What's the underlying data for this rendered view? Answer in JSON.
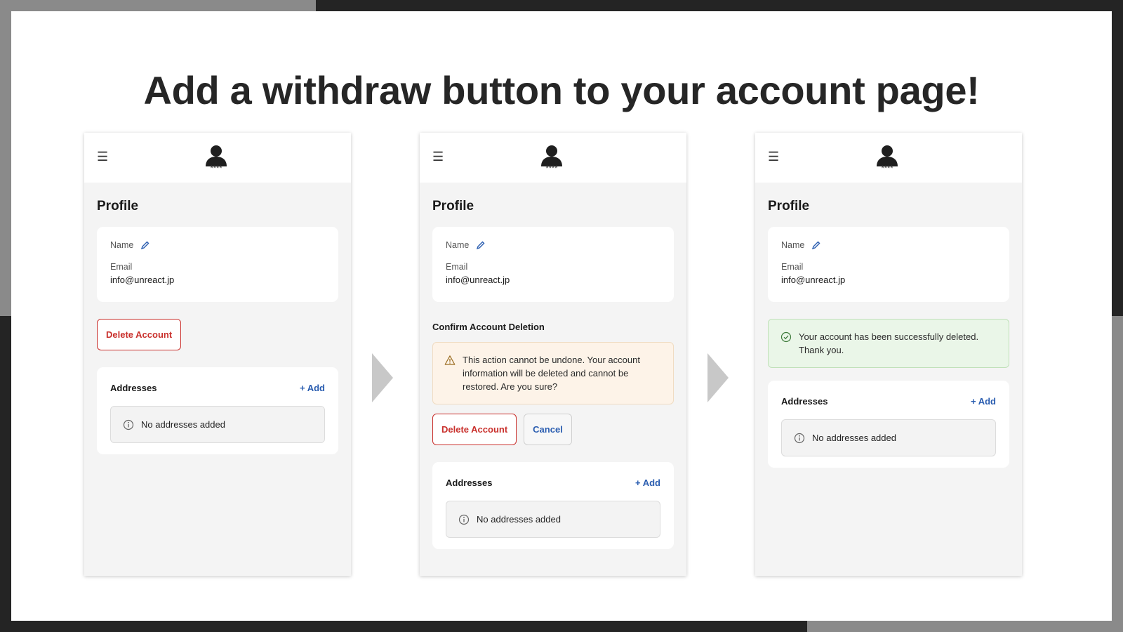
{
  "headline": "Add a withdraw button to your account page!",
  "logo_stars": "****",
  "screens": [
    {
      "profile_title": "Profile",
      "name_label": "Name",
      "email_label": "Email",
      "email_value": "info@unreact.jp",
      "delete_button": "Delete Account",
      "addresses_title": "Addresses",
      "add_link": "+ Add",
      "empty_text": "No addresses added"
    },
    {
      "profile_title": "Profile",
      "name_label": "Name",
      "email_label": "Email",
      "email_value": "info@unreact.jp",
      "confirm_title": "Confirm Account Deletion",
      "warning_text": "This action cannot be undone. Your account information will be deleted and cannot be restored. Are you sure?",
      "delete_button": "Delete Account",
      "cancel_button": "Cancel",
      "addresses_title": "Addresses",
      "add_link": "+ Add",
      "empty_text": "No addresses added"
    },
    {
      "profile_title": "Profile",
      "name_label": "Name",
      "email_label": "Email",
      "email_value": "info@unreact.jp",
      "success_text": "Your account has been successfully deleted. Thank you.",
      "addresses_title": "Addresses",
      "add_link": "+ Add",
      "empty_text": "No addresses added"
    }
  ],
  "colors": {
    "danger": "#c9302c",
    "link": "#2a5db0",
    "warning_bg": "#fdf3e8",
    "success_bg": "#eaf6e8"
  },
  "icons": [
    "menu-icon",
    "user-logo-icon",
    "pencil-icon",
    "info-icon",
    "warning-icon",
    "check-circle-icon",
    "arrow-right-icon"
  ]
}
